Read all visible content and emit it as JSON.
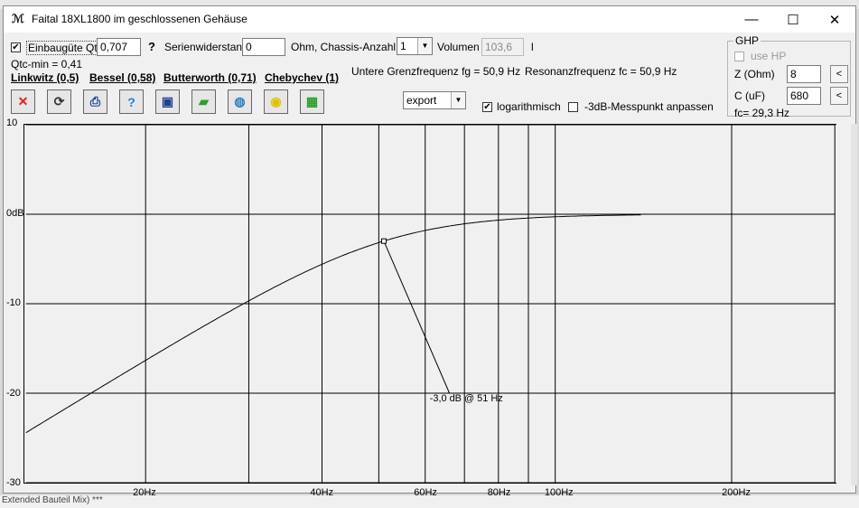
{
  "background": {
    "bottom_text": "Extended Bauteil Mix) ***"
  },
  "window": {
    "title": "Faital 18XL1800 im geschlossenen Gehäuse",
    "icon": "app-icon",
    "min_symbol": "—",
    "max_symbol": "☐",
    "close_symbol": "✕"
  },
  "controls": {
    "qtc_label": "Einbaugüte Qtc",
    "qtc_value": "0,707",
    "qtc_checked": true,
    "help_symbol": "?",
    "serien_label": "Serienwiderstand",
    "serien_value": "0",
    "ohm_chassis_label": "Ohm, Chassis-Anzahl",
    "chassis_count": "1",
    "volumen_label": "Volumen",
    "volumen_value": "103,6",
    "volumen_unit": "l",
    "qtc_min": "Qtc-min = 0,41",
    "fg_text": "Untere Grenzfrequenz fg = 50,9 Hz",
    "fc_text": "Resonanzfrequenz fc = 50,9 Hz",
    "export_value": "export",
    "log_label": "logarithmisch",
    "log_checked": true,
    "adjust_label": "-3dB-Messpunkt anpassen",
    "adjust_checked": false
  },
  "presets": [
    {
      "label": "Linkwitz (0,5)"
    },
    {
      "label": "Bessel (0,58)"
    },
    {
      "label": "Butterworth (0,71)"
    },
    {
      "label": "Chebychev (1)"
    }
  ],
  "toolbar": [
    {
      "icon": "close-red-icon",
      "glyph": "✕",
      "color": "#e02020"
    },
    {
      "icon": "refresh-icon",
      "glyph": "⟳",
      "color": "#333333"
    },
    {
      "icon": "print-icon",
      "glyph": "⎙",
      "color": "#1f3f8f"
    },
    {
      "icon": "help-icon",
      "glyph": "?",
      "color": "#1e7fd6"
    },
    {
      "icon": "save-icon",
      "glyph": "▣",
      "color": "#1f3f8f"
    },
    {
      "icon": "open-folder-icon",
      "glyph": "▰",
      "color": "#2e9e2e"
    },
    {
      "icon": "globe-icon",
      "glyph": "◍",
      "color": "#2a7fc0"
    },
    {
      "icon": "lightbulb-icon",
      "glyph": "◉",
      "color": "#e0c000"
    },
    {
      "icon": "calculator-icon",
      "glyph": "▦",
      "color": "#2e9e2e"
    }
  ],
  "ghp": {
    "title": "GHP",
    "use_hp_label": "use HP",
    "use_hp_checked": false,
    "z_label": "Z (Ohm)",
    "z_value": "8",
    "c_label": "C (uF)",
    "c_value": "680",
    "fc_text": "fc= 29,3 Hz",
    "arrow_symbol": "<"
  },
  "chart_data": {
    "type": "line",
    "xscale": "log",
    "xlim": [
      12.5,
      300
    ],
    "ylim": [
      -30,
      10
    ],
    "yticks": [
      "10",
      "0dB",
      "-10",
      "-20",
      "-30"
    ],
    "yticks_values": [
      10,
      0,
      -10,
      -20,
      -30
    ],
    "xtick_labels": [
      "20Hz",
      "40Hz",
      "60Hz",
      "80Hz",
      "100Hz",
      "200Hz"
    ],
    "xtick_values": [
      20,
      40,
      60,
      80,
      100,
      200
    ],
    "x_gridlines": [
      20,
      30,
      40,
      50,
      60,
      70,
      80,
      90,
      100,
      200,
      300
    ],
    "fc": 50.9,
    "qtc": 0.707,
    "curve_end": 140,
    "marker": {
      "x": 51,
      "y": -3.0,
      "label": "-3,0 dB @ 51 Hz",
      "label_x": 66,
      "label_y": -20
    }
  }
}
